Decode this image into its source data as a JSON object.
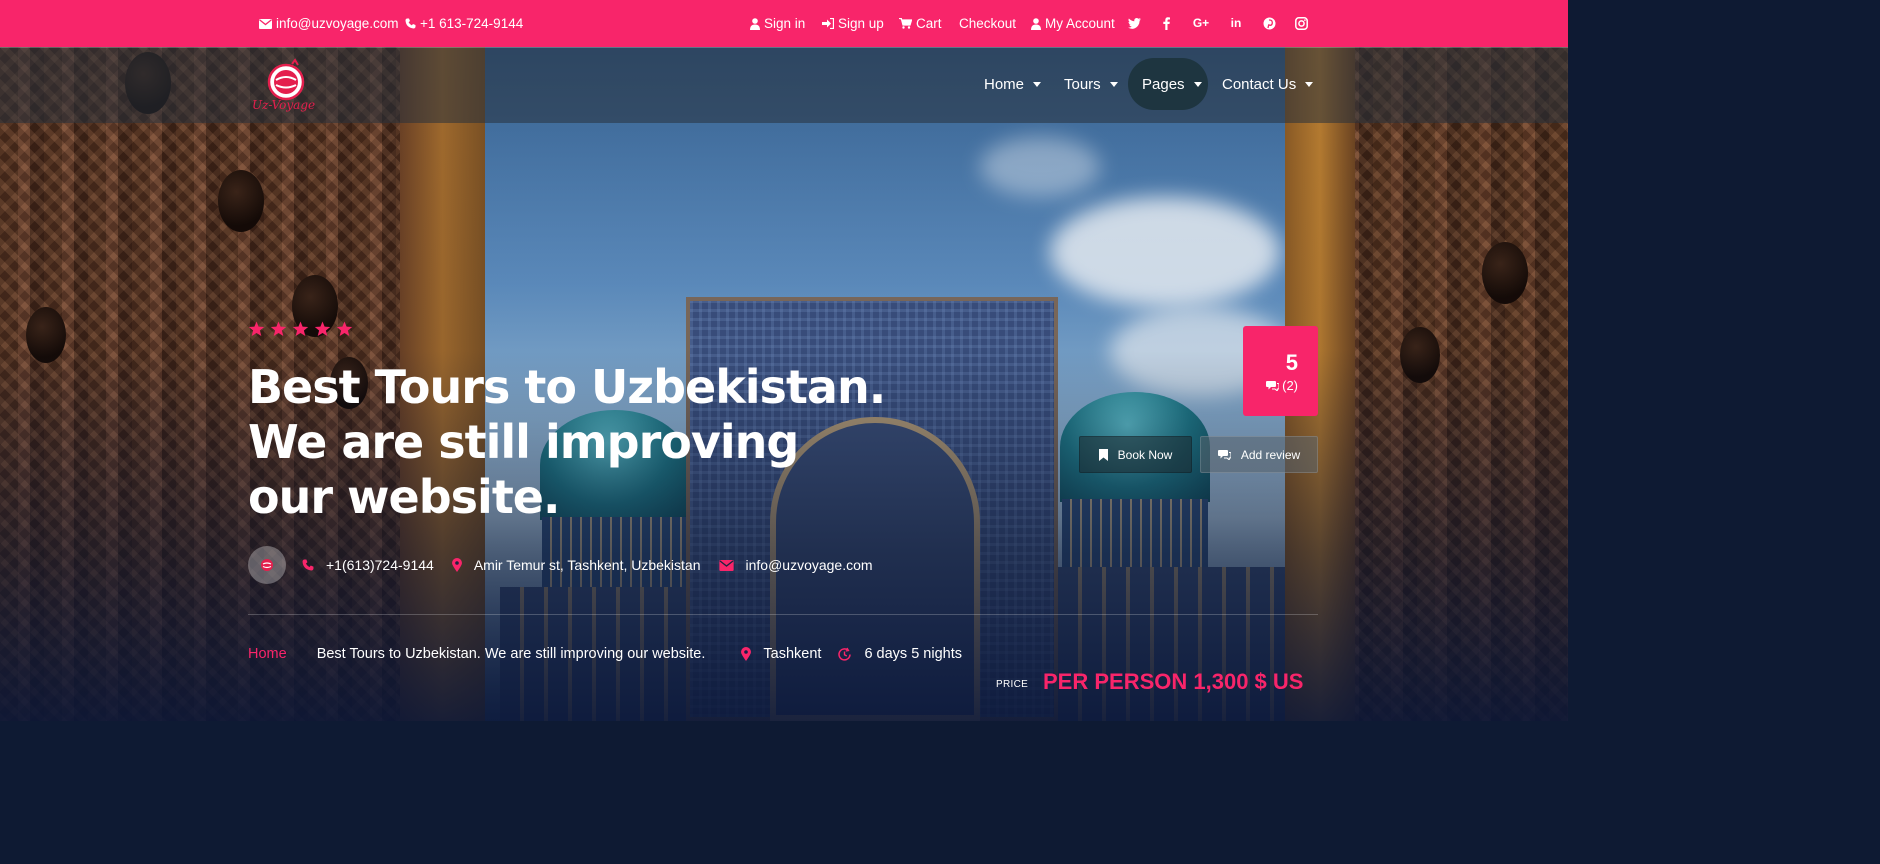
{
  "topbar": {
    "email": "info@uzvoyage.com",
    "phone": "+1 613-724-9144",
    "sign_in": "Sign in",
    "sign_up": "Sign up",
    "cart": "Cart",
    "checkout": "Checkout",
    "my_account": "My Account",
    "social": [
      "twitter-icon",
      "facebook-icon",
      "google-plus-icon",
      "linkedin-icon",
      "pinterest-icon",
      "instagram-icon"
    ]
  },
  "logo": {
    "text": "Uz-Voyage"
  },
  "nav": {
    "items": [
      {
        "label": "Home",
        "active": false
      },
      {
        "label": "Tours",
        "active": false
      },
      {
        "label": "Pages",
        "active": true
      },
      {
        "label": "Contact Us",
        "active": false
      }
    ]
  },
  "hero": {
    "stars": 5,
    "headline": "Best Tours to Uzbekistan. We are still improving our website.",
    "phone": "+1(613)724-9144",
    "address": "Amir Temur st, Tashkent, Uzbekistan",
    "email": "info@uzvoyage.com"
  },
  "rating": {
    "score": "5",
    "reviews": "(2)"
  },
  "buttons": {
    "book_now": "Book Now",
    "add_review": "Add review"
  },
  "breadcrumb": {
    "home": "Home",
    "current": "Best Tours to Uzbekistan. We are still improving our website.",
    "location": "Tashkent",
    "duration": "6 days 5 nights"
  },
  "price": {
    "label": "PRICE",
    "value": "PER PERSON 1,300 $ US"
  },
  "colors": {
    "accent": "#f8256a",
    "nav_active": "#1e3540"
  }
}
